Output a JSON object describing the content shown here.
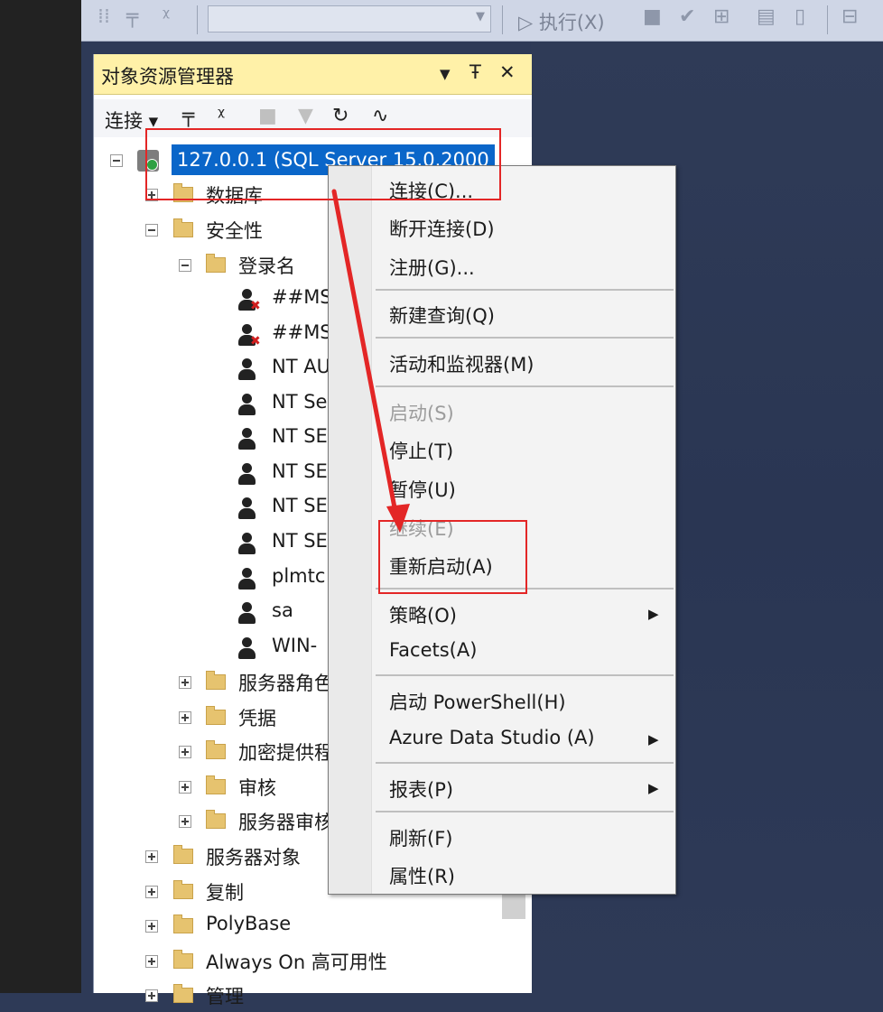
{
  "toolbar": {
    "execute_label": "▷ 执行(X)"
  },
  "explorer": {
    "title": "对象资源管理器",
    "pin_glyph": "ᵖ",
    "connect_label": "连接 ▾",
    "server_node": "127.0.0.1 (SQL Server 15.0.2000"
  },
  "tree": {
    "databases": "数据库",
    "security": "安全性",
    "logins": "登录名",
    "login_items": [
      "##MS",
      "##MS",
      "NT AU",
      "NT Se",
      "NT SE",
      "NT SE",
      "NT SE",
      "NT SE",
      "plmtc",
      "sa",
      "WIN-"
    ],
    "security_children": [
      "服务器角色",
      "凭据",
      "加密提供程",
      "审核",
      "服务器审核"
    ],
    "root_children": [
      "服务器对象",
      "复制",
      "PolyBase",
      "Always On 高可用性",
      "管理"
    ]
  },
  "context_menu": {
    "items": {
      "connect": "连接(C)...",
      "disconnect": "断开连接(D)",
      "register": "注册(G)...",
      "new_query": "新建查询(Q)",
      "activity_monitor": "活动和监视器(M)",
      "start": "启动(S)",
      "stop": "停止(T)",
      "pause": "暂停(U)",
      "resume": "继续(E)",
      "restart": "重新启动(A)",
      "policies": "策略(O)",
      "facets": "Facets(A)",
      "powershell": "启动 PowerShell(H)",
      "azure_data_studio": "Azure Data Studio (A)",
      "reports": "报表(P)",
      "refresh": "刷新(F)",
      "properties": "属性(R)"
    },
    "submenu_arrow": "▶"
  },
  "annotation": {
    "color": "#e32626"
  }
}
